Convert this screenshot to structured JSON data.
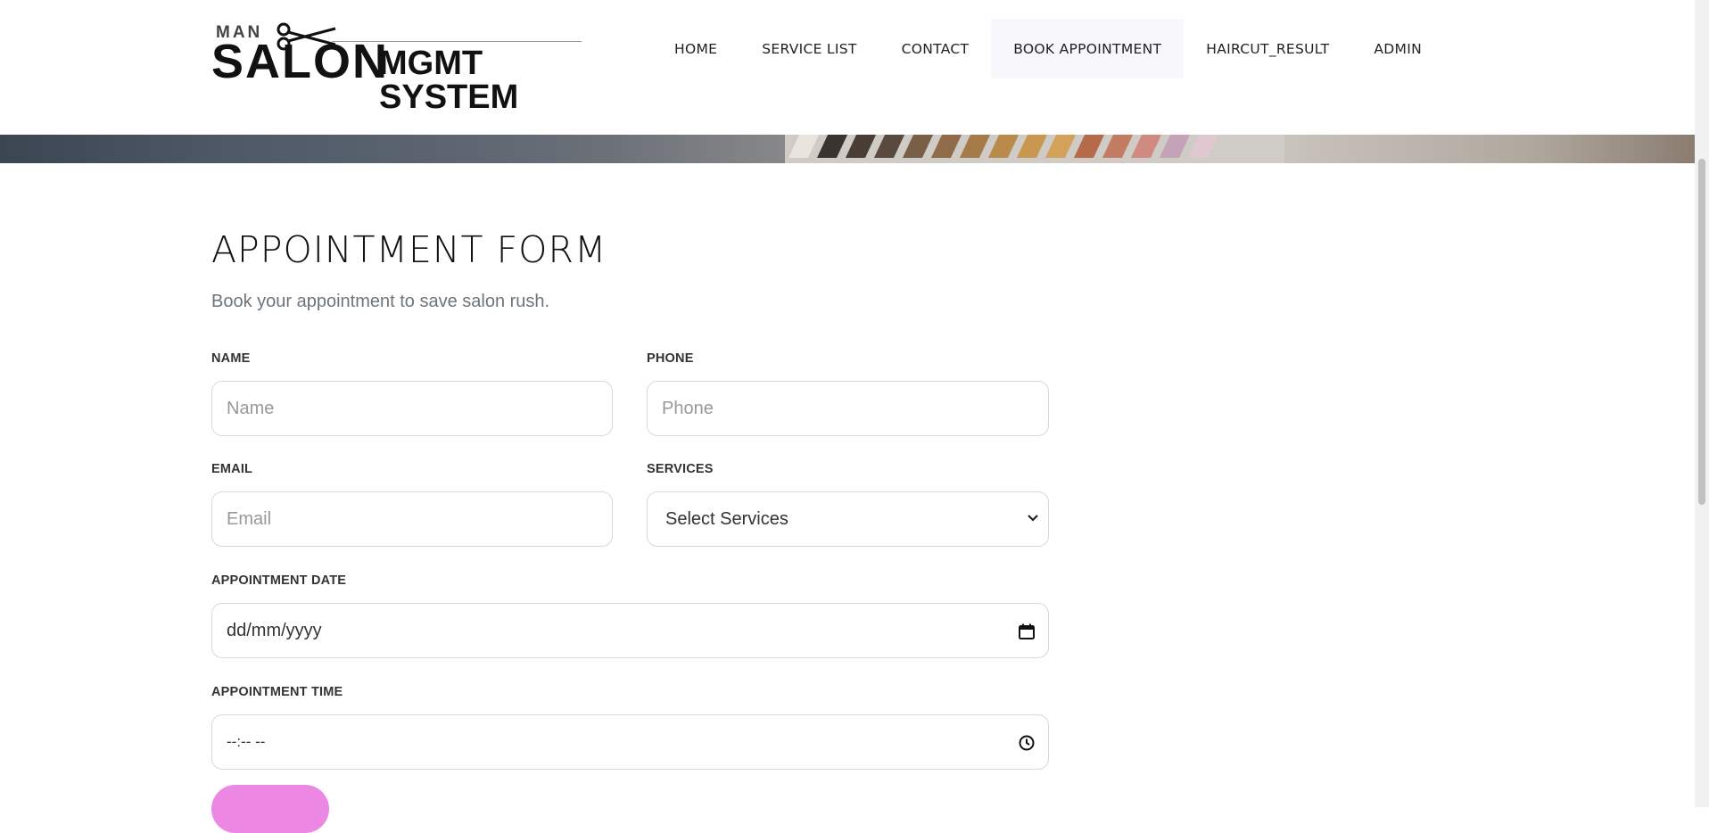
{
  "logo": {
    "top_text": "MAN",
    "main_text": "SALON",
    "suffix_text": "MGMT SYSTEM"
  },
  "nav": {
    "items": [
      {
        "label": "HOME"
      },
      {
        "label": "SERVICE LIST"
      },
      {
        "label": "CONTACT"
      },
      {
        "label": "BOOK APPOINTMENT",
        "active": true
      },
      {
        "label": "HAIRCUT_RESULT"
      },
      {
        "label": "ADMIN"
      }
    ]
  },
  "form": {
    "title": "APPOINTMENT FORM",
    "subtitle": "Book your appointment to save salon rush.",
    "name": {
      "label": "NAME",
      "placeholder": "Name"
    },
    "phone": {
      "label": "PHONE",
      "placeholder": "Phone"
    },
    "email": {
      "label": "EMAIL",
      "placeholder": "Email"
    },
    "services": {
      "label": "SERVICES",
      "selected": "Select Services"
    },
    "date": {
      "label": "APPOINTMENT DATE",
      "placeholder": "dd/mm/yyyy"
    },
    "time": {
      "label": "APPOINTMENT TIME",
      "placeholder": "--:-- --"
    }
  },
  "colors": {
    "submit_button": "#ec88e3",
    "active_nav_bg": "#f8f7fc"
  }
}
